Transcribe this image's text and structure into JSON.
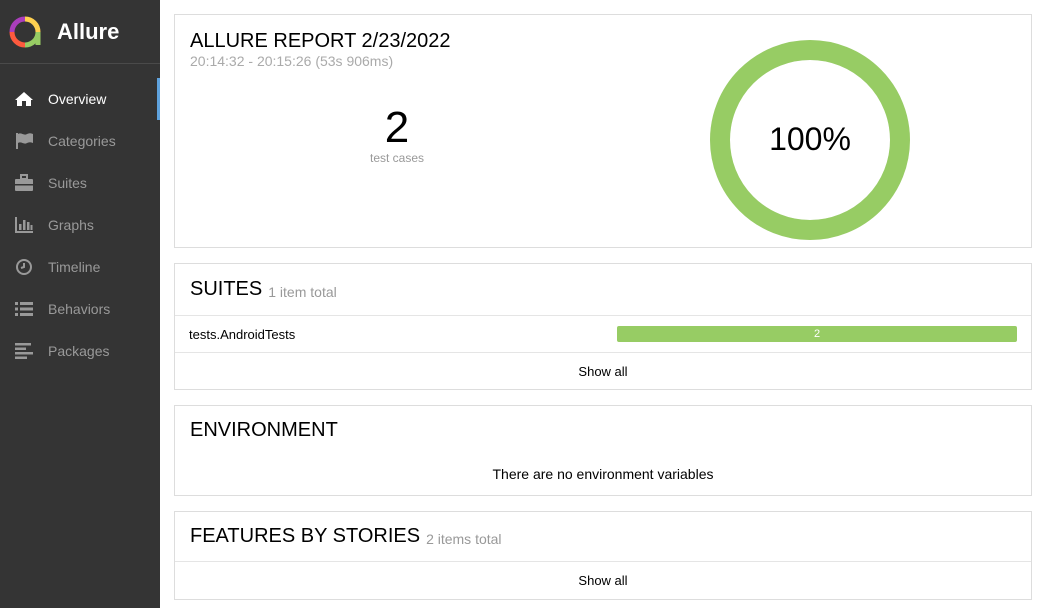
{
  "sidebar": {
    "brand": "Allure",
    "items": [
      {
        "label": "Overview",
        "icon": "home-icon",
        "active": true
      },
      {
        "label": "Categories",
        "icon": "flag-icon",
        "active": false
      },
      {
        "label": "Suites",
        "icon": "briefcase-icon",
        "active": false
      },
      {
        "label": "Graphs",
        "icon": "bar-chart-icon",
        "active": false
      },
      {
        "label": "Timeline",
        "icon": "clock-icon",
        "active": false
      },
      {
        "label": "Behaviors",
        "icon": "list-icon",
        "active": false
      },
      {
        "label": "Packages",
        "icon": "align-left-icon",
        "active": false
      }
    ]
  },
  "summary": {
    "title": "ALLURE REPORT 2/23/2022",
    "time": "20:14:32 - 20:15:26 (53s 906ms)",
    "count": "2",
    "count_label": "test cases",
    "percent": "100%",
    "passed_fraction": 1.0
  },
  "suites": {
    "title": "SUITES",
    "subtitle": "1 item total",
    "rows": [
      {
        "name": "tests.AndroidTests",
        "passed": "2"
      }
    ],
    "show_all": "Show all"
  },
  "environment": {
    "title": "ENVIRONMENT",
    "empty": "There are no environment variables"
  },
  "features": {
    "title": "FEATURES BY STORIES",
    "subtitle": "2 items total",
    "show_all": "Show all"
  },
  "colors": {
    "sidebar_bg": "#343434",
    "passed": "#97cc64",
    "active_marker": "#5fa2dd"
  }
}
